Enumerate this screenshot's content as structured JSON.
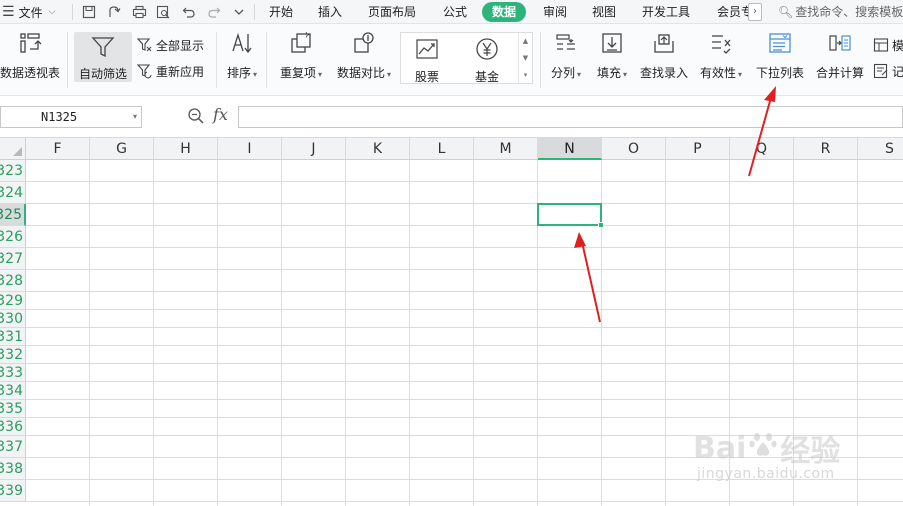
{
  "menubar": {
    "file_label": "文件",
    "tabs": [
      {
        "label": "开始",
        "active": false
      },
      {
        "label": "插入",
        "active": false
      },
      {
        "label": "页面布局",
        "active": false
      },
      {
        "label": "公式",
        "active": false
      },
      {
        "label": "数据",
        "active": true
      },
      {
        "label": "审阅",
        "active": false
      },
      {
        "label": "视图",
        "active": false
      },
      {
        "label": "开发工具",
        "active": false
      },
      {
        "label": "会员专",
        "active": false
      }
    ],
    "more_label": "›",
    "search_text": "查找命令、搜索模板",
    "icons": [
      "save-icon",
      "export-icon",
      "print-icon",
      "print-preview-icon",
      "undo-icon",
      "redo-icon",
      "customize-icon"
    ]
  },
  "ribbon": {
    "pivot_label": "数据透视表",
    "autofilter_label": "自动筛选",
    "show_all_label": "全部显示",
    "reapply_label": "重新应用",
    "sort_label": "排序",
    "duplicates_label": "重复项",
    "compare_label": "数据对比",
    "stock_label": "股票",
    "fund_label": "基金",
    "split_label": "分列",
    "fill_label": "填充",
    "lookup_label": "查找录入",
    "validity_label": "有效性",
    "dropdown_list_label": "下拉列表",
    "consolidate_label": "合并计算",
    "cut_label_1": "模",
    "cut_label_2": "记"
  },
  "formula_bar": {
    "name_box": "N1325",
    "fx_label": "fx",
    "formula": ""
  },
  "sheet": {
    "columns": [
      "F",
      "G",
      "H",
      "I",
      "J",
      "K",
      "L",
      "M",
      "N",
      "O",
      "P",
      "Q",
      "R",
      "S"
    ],
    "rows": [
      "323",
      "324",
      "325",
      "326",
      "327",
      "328",
      "329",
      "330",
      "331",
      "332",
      "333",
      "334",
      "335",
      "336",
      "337",
      "338",
      "339"
    ],
    "selected_column": "N",
    "selected_row": "325"
  },
  "watermark": {
    "logo_text_left": "Bai",
    "logo_text_right": "经验",
    "url": "jingyan.baidu.com"
  },
  "colors": {
    "accent": "#2db47a",
    "arrow": "#e02020"
  }
}
